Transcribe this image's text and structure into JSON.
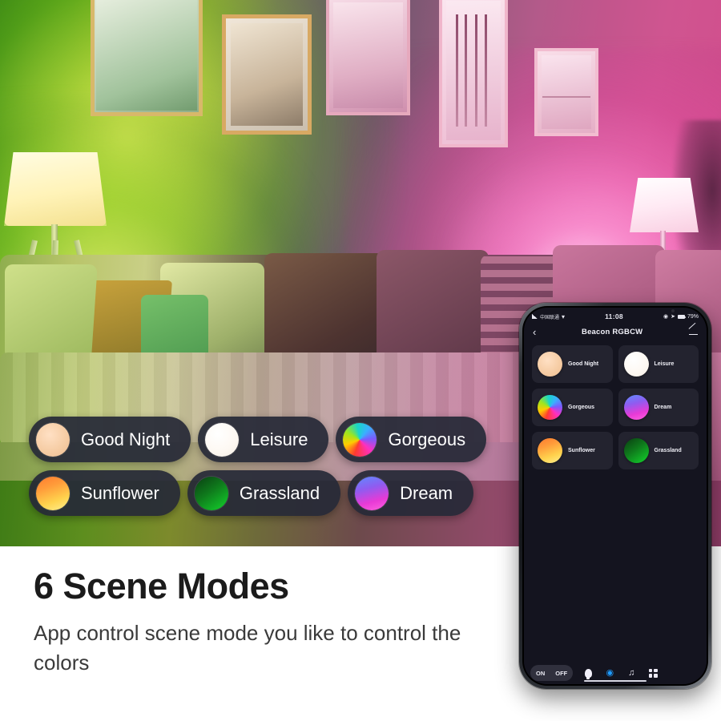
{
  "photo": {
    "alt_description": "living room with sofa lit by green and pink smart lamps"
  },
  "scene_chips": {
    "rows": [
      [
        {
          "label": "Good Night",
          "swatch": "sw-goodnight",
          "icon": "scene-swatch-icon"
        },
        {
          "label": "Leisure",
          "swatch": "sw-leisure",
          "icon": "scene-swatch-icon"
        },
        {
          "label": "Gorgeous",
          "swatch": "sw-gorgeous",
          "icon": "scene-swatch-icon"
        }
      ],
      [
        {
          "label": "Sunflower",
          "swatch": "sw-sunflower",
          "icon": "scene-swatch-icon"
        },
        {
          "label": "Grassland",
          "swatch": "sw-grassland",
          "icon": "scene-swatch-icon"
        },
        {
          "label": "Dream",
          "swatch": "sw-dream",
          "icon": "scene-swatch-icon"
        }
      ]
    ]
  },
  "copy": {
    "headline": "6 Scene Modes",
    "subcopy": "App control scene mode you like to control the colors"
  },
  "phone": {
    "statusbar": {
      "carrier": "中国联通",
      "time": "11:08",
      "battery": "79%"
    },
    "navbar": {
      "back_icon": "chevron-left-icon",
      "title": "Beacon RGBCW",
      "edit_icon": "pencil-edit-icon"
    },
    "scenes": [
      {
        "label": "Good Night",
        "swatch": "sw-goodnight"
      },
      {
        "label": "Leisure",
        "swatch": "sw-leisure"
      },
      {
        "label": "Gorgeous",
        "swatch": "sw-gorgeous"
      },
      {
        "label": "Dream",
        "swatch": "sw-dream"
      },
      {
        "label": "Sunflower",
        "swatch": "sw-sunflower"
      },
      {
        "label": "Grassland",
        "swatch": "sw-grassland"
      }
    ],
    "tabbar": {
      "on_label": "ON",
      "off_label": "OFF",
      "icons": [
        {
          "name": "bulb-icon",
          "glyph": "",
          "active": false
        },
        {
          "name": "palette-icon",
          "glyph": "◕",
          "active": true
        },
        {
          "name": "music-icon",
          "glyph": "♫",
          "active": false
        },
        {
          "name": "grid-icon",
          "glyph": "",
          "active": false
        }
      ]
    }
  },
  "colors": {
    "accent": "#1e9bff",
    "chip_bg": "#262937",
    "screen_bg": "#14141f",
    "card_bg": "#23232f",
    "headline": "#1b1b1b"
  }
}
